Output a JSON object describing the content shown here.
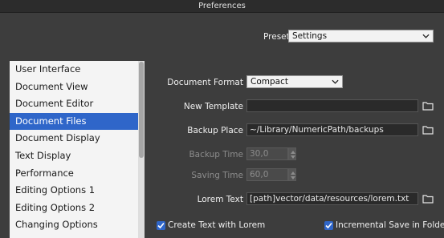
{
  "window": {
    "title": "Preferences"
  },
  "presets": {
    "label": "Presets",
    "value": "Settings"
  },
  "sidebar": {
    "items": [
      {
        "label": "User Interface"
      },
      {
        "label": "Document View"
      },
      {
        "label": "Document Editor"
      },
      {
        "label": "Document Files",
        "selected": true
      },
      {
        "label": "Document Display"
      },
      {
        "label": "Text Display"
      },
      {
        "label": "Performance"
      },
      {
        "label": "Editing Options 1"
      },
      {
        "label": "Editing Options 2"
      },
      {
        "label": "Changing Options"
      }
    ]
  },
  "form": {
    "document_format": {
      "label": "Document Format",
      "value": "Compact"
    },
    "new_template": {
      "label": "New Template",
      "value": ""
    },
    "backup_place": {
      "label": "Backup Place",
      "value": "~/Library/NumericPath/backups"
    },
    "backup_time": {
      "label": "Backup Time",
      "value": "30,0"
    },
    "saving_time": {
      "label": "Saving Time",
      "value": "60,0"
    },
    "lorem_text": {
      "label": "Lorem Text",
      "value": "[path]vector/data/resources/lorem.txt"
    },
    "create_text_with_lorem": {
      "label": "Create Text with Lorem",
      "checked": true
    },
    "incremental_save": {
      "label": "Incremental Save in Folder",
      "checked": true
    }
  },
  "icons": {
    "folder": "folder-icon",
    "chevron": "chevron-down-icon",
    "check": "checkmark-icon",
    "spin": "spinner-arrows-icon"
  },
  "colors": {
    "background": "#3d3d3d",
    "selection": "#2f66c9",
    "sidebar_bg": "#f4f4f4"
  }
}
